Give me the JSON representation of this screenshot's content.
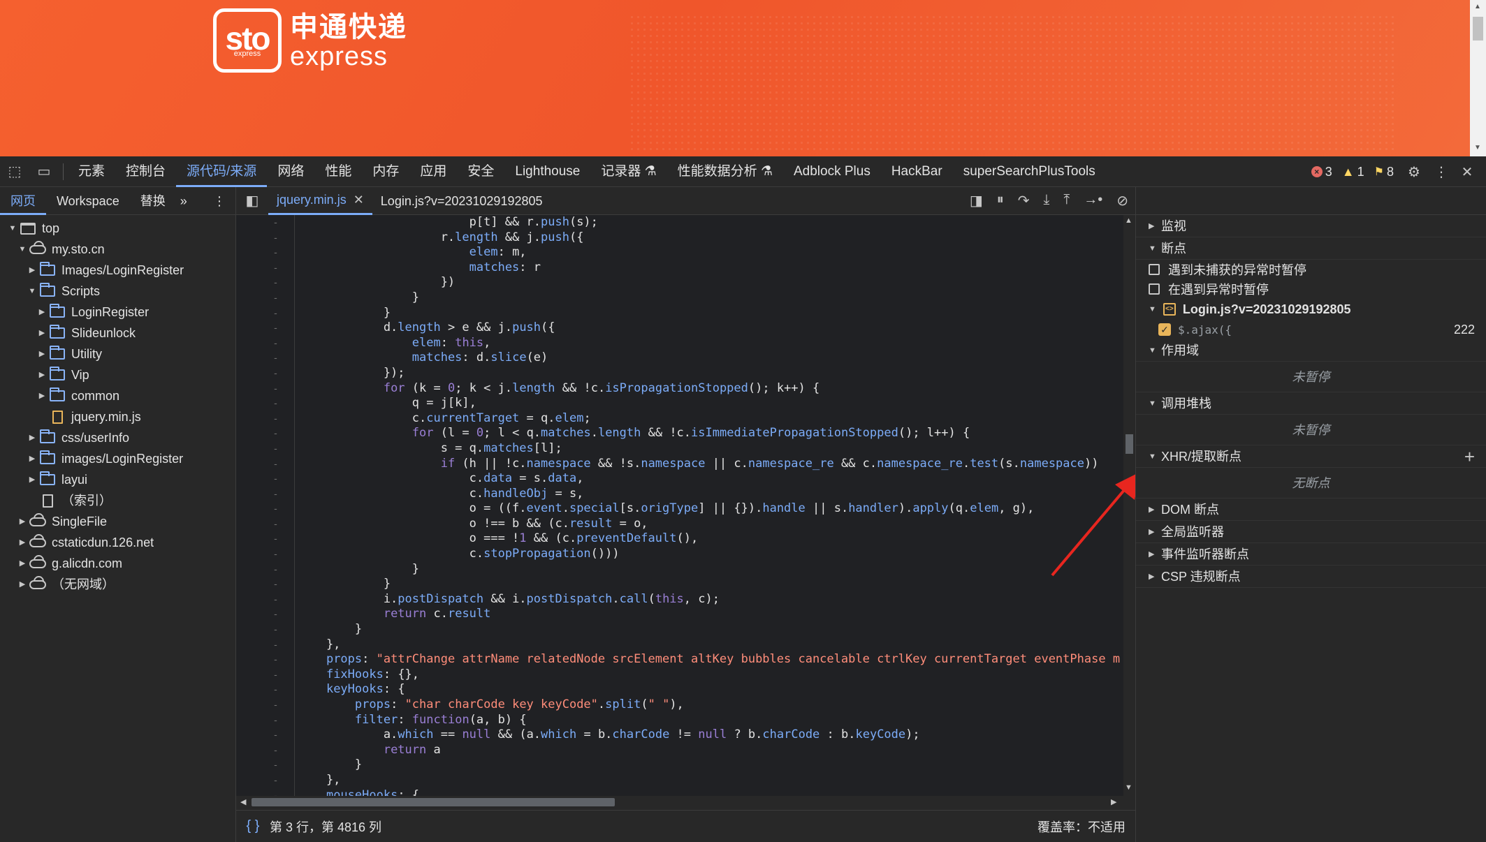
{
  "page": {
    "logo_mark": "sto",
    "logo_mark_small": "express",
    "logo_cn": "申通快递",
    "logo_en": "express"
  },
  "devtools": {
    "tabs": [
      {
        "label": "元素",
        "active": false
      },
      {
        "label": "控制台",
        "active": false
      },
      {
        "label": "源代码/来源",
        "active": true
      },
      {
        "label": "网络",
        "active": false
      },
      {
        "label": "性能",
        "active": false
      },
      {
        "label": "内存",
        "active": false
      },
      {
        "label": "应用",
        "active": false
      },
      {
        "label": "安全",
        "active": false
      },
      {
        "label": "Lighthouse",
        "active": false
      },
      {
        "label": "记录器 ⚗",
        "active": false
      },
      {
        "label": "性能数据分析 ⚗",
        "active": false
      },
      {
        "label": "Adblock Plus",
        "active": false
      },
      {
        "label": "HackBar",
        "active": false
      },
      {
        "label": "superSearchPlusTools",
        "active": false
      }
    ],
    "errors": "3",
    "warnings": "1",
    "issues": "8"
  },
  "navigator": {
    "tabs": [
      "网页",
      "Workspace",
      "替换"
    ],
    "more": "»",
    "tree": [
      {
        "label": "top",
        "icon": "frame",
        "depth": 0,
        "open": true
      },
      {
        "label": "my.sto.cn",
        "icon": "cloud",
        "depth": 1,
        "open": true
      },
      {
        "label": "Images/LoginRegister",
        "icon": "folder",
        "depth": 2,
        "open": false
      },
      {
        "label": "Scripts",
        "icon": "folder",
        "depth": 2,
        "open": true
      },
      {
        "label": "LoginRegister",
        "icon": "folder",
        "depth": 3,
        "open": false
      },
      {
        "label": "Slideunlock",
        "icon": "folder",
        "depth": 3,
        "open": false
      },
      {
        "label": "Utility",
        "icon": "folder",
        "depth": 3,
        "open": false
      },
      {
        "label": "Vip",
        "icon": "folder",
        "depth": 3,
        "open": false
      },
      {
        "label": "common",
        "icon": "folder",
        "depth": 3,
        "open": false
      },
      {
        "label": "jquery.min.js",
        "icon": "file-js",
        "depth": 3,
        "open": null
      },
      {
        "label": "css/userInfo",
        "icon": "folder",
        "depth": 2,
        "open": false
      },
      {
        "label": "images/LoginRegister",
        "icon": "folder",
        "depth": 2,
        "open": false
      },
      {
        "label": "layui",
        "icon": "folder",
        "depth": 2,
        "open": false
      },
      {
        "label": "（索引）",
        "icon": "file",
        "depth": 2,
        "open": null
      },
      {
        "label": "SingleFile",
        "icon": "cloud",
        "depth": 1,
        "open": false
      },
      {
        "label": "cstaticdun.126.net",
        "icon": "cloud",
        "depth": 1,
        "open": false
      },
      {
        "label": "g.alicdn.com",
        "icon": "cloud",
        "depth": 1,
        "open": false
      },
      {
        "label": "（无网域）",
        "icon": "cloud",
        "depth": 1,
        "open": false
      }
    ]
  },
  "editor": {
    "tabs": [
      {
        "label": "jquery.min.js",
        "active": true,
        "closable": true
      },
      {
        "label": "Login.js?v=20231029192805",
        "active": false,
        "closable": false
      }
    ],
    "lines": [
      "                        p[t] && r.push(s);",
      "                    r.length && j.push({",
      "                        elem: m,",
      "                        matches: r",
      "                    })",
      "                }",
      "            }",
      "            d.length > e && j.push({",
      "                elem: this,",
      "                matches: d.slice(e)",
      "            });",
      "            for (k = 0; k < j.length && !c.isPropagationStopped(); k++) {",
      "                q = j[k],",
      "                c.currentTarget = q.elem;",
      "                for (l = 0; l < q.matches.length && !c.isImmediatePropagationStopped(); l++) {",
      "                    s = q.matches[l];",
      "                    if (h || !c.namespace && !s.namespace || c.namespace_re && c.namespace_re.test(s.namespace))",
      "                        c.data = s.data,",
      "                        c.handleObj = s,",
      "                        o = ((f.event.special[s.origType] || {}).handle || s.handler).apply(q.elem, g),",
      "                        o !== b && (c.result = o,",
      "                        o === !1 && (c.preventDefault(),",
      "                        c.stopPropagation()))",
      "                }",
      "            }",
      "            i.postDispatch && i.postDispatch.call(this, c);",
      "            return c.result",
      "        }",
      "    },",
      "    props: \"attrChange attrName relatedNode srcElement altKey bubbles cancelable ctrlKey currentTarget eventPhase m",
      "    fixHooks: {},",
      "    keyHooks: {",
      "        props: \"char charCode key keyCode\".split(\" \"),",
      "        filter: function(a, b) {",
      "            a.which == null && (a.which = b.charCode != null ? b.charCode : b.keyCode);",
      "            return a",
      "        }",
      "    },",
      "    mouseHooks: {"
    ],
    "gutter_mark": "-",
    "status_braces": "{ }",
    "status_position": "第 3 行，第 4816 列",
    "coverage": "覆盖率：不适用"
  },
  "sidebar": {
    "watch": "监视",
    "breakpoints": "断点",
    "pause_uncaught": "遇到未捕获的异常时暂停",
    "pause_caught": "在遇到异常时暂停",
    "bp_file": "Login.js?v=20231029192805",
    "bp_code": "$.ajax({",
    "bp_line": "222",
    "scope": "作用域",
    "scope_empty": "未暂停",
    "callstack": "调用堆栈",
    "callstack_empty": "未暂停",
    "xhr": "XHR/提取断点",
    "xhr_empty": "无断点",
    "dom": "DOM 断点",
    "global": "全局监听器",
    "event": "事件监听器断点",
    "csp": "CSP 违规断点"
  },
  "colors": {
    "banner": "#f25a2c",
    "accent": "#7cacf8",
    "annotation_arrow": "#e8261f"
  }
}
